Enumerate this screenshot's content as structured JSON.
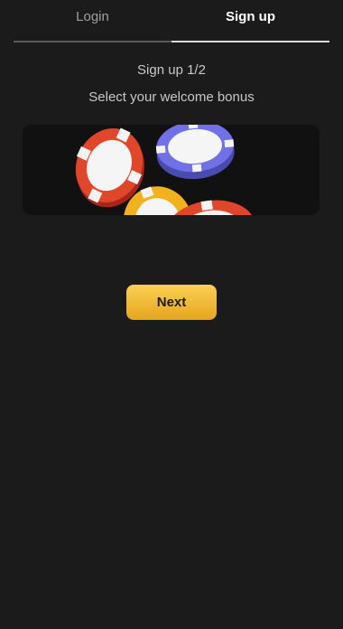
{
  "tabs": {
    "login": "Login",
    "signup": "Sign up"
  },
  "step": "Sign up 1/2",
  "subtitle": "Select your welcome bonus",
  "bonus_card": {
    "image": "casino-chips"
  },
  "next_button": "Next",
  "colors": {
    "background": "#1b1b1b",
    "button": "#f3bd3a",
    "chip_red": "#e0462a",
    "chip_blue": "#7071e6",
    "chip_yellow": "#f2b21e"
  }
}
